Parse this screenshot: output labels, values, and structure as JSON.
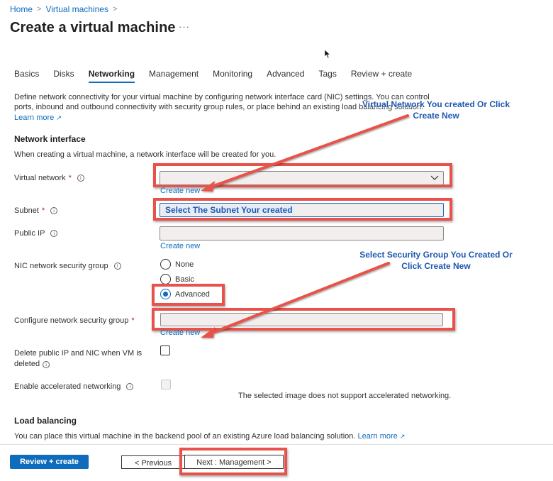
{
  "breadcrumb": [
    {
      "label": "Home"
    },
    {
      "label": "Virtual machines"
    }
  ],
  "page_title": "Create a virtual machine",
  "more_label": "···",
  "tabs": [
    {
      "label": "Basics",
      "active": false
    },
    {
      "label": "Disks",
      "active": false
    },
    {
      "label": "Networking",
      "active": true
    },
    {
      "label": "Management",
      "active": false
    },
    {
      "label": "Monitoring",
      "active": false
    },
    {
      "label": "Advanced",
      "active": false
    },
    {
      "label": "Tags",
      "active": false
    },
    {
      "label": "Review + create",
      "active": false
    }
  ],
  "description": {
    "text": "Define network connectivity for your virtual machine by configuring network interface card (NIC) settings. You can control ports, inbound and outbound connectivity with security group rules, or place behind an existing load balancing solution.",
    "learn_more": "Learn more"
  },
  "network_interface": {
    "heading": "Network interface",
    "subtext": "When creating a virtual machine, a network interface will be created for you.",
    "virtual_network": {
      "label": "Virtual network",
      "value": "",
      "create_new": "Create new"
    },
    "subnet": {
      "label": "Subnet",
      "value": "Select The Subnet Your created"
    },
    "public_ip": {
      "label": "Public IP",
      "value": "",
      "create_new": "Create new"
    },
    "nic_nsg": {
      "label": "NIC network security group",
      "options": [
        "None",
        "Basic",
        "Advanced"
      ],
      "selected": "Advanced"
    },
    "configure_nsg": {
      "label": "Configure network security group",
      "value": "",
      "create_new": "Create new"
    },
    "delete_public_ip": {
      "label_line1": "Delete public IP and NIC when VM is",
      "label_line2": "deleted",
      "checked": false
    },
    "accelerated_networking": {
      "label": "Enable accelerated networking",
      "checked": false,
      "disabled": true,
      "note": "The selected image does not support accelerated networking."
    }
  },
  "load_balancing": {
    "heading": "Load balancing",
    "text": "You can place this virtual machine in the backend pool of an existing Azure load balancing solution.",
    "learn_more": "Learn more"
  },
  "annotations": {
    "vnet_callout_line1": "Virtual Network You created Or Click",
    "vnet_callout_line2": "Create New",
    "nsg_callout_line1": "Select Security Group You Created Or",
    "nsg_callout_line2": "Click Create New",
    "annotation_color": "#e8524a",
    "callout_color": "#1e58b0"
  },
  "footer": {
    "review_create": "Review + create",
    "previous": "< Previous",
    "next": "Next : Management >"
  },
  "colors": {
    "accent": "#0f6cbd",
    "input_fill": "#f3eeee"
  }
}
